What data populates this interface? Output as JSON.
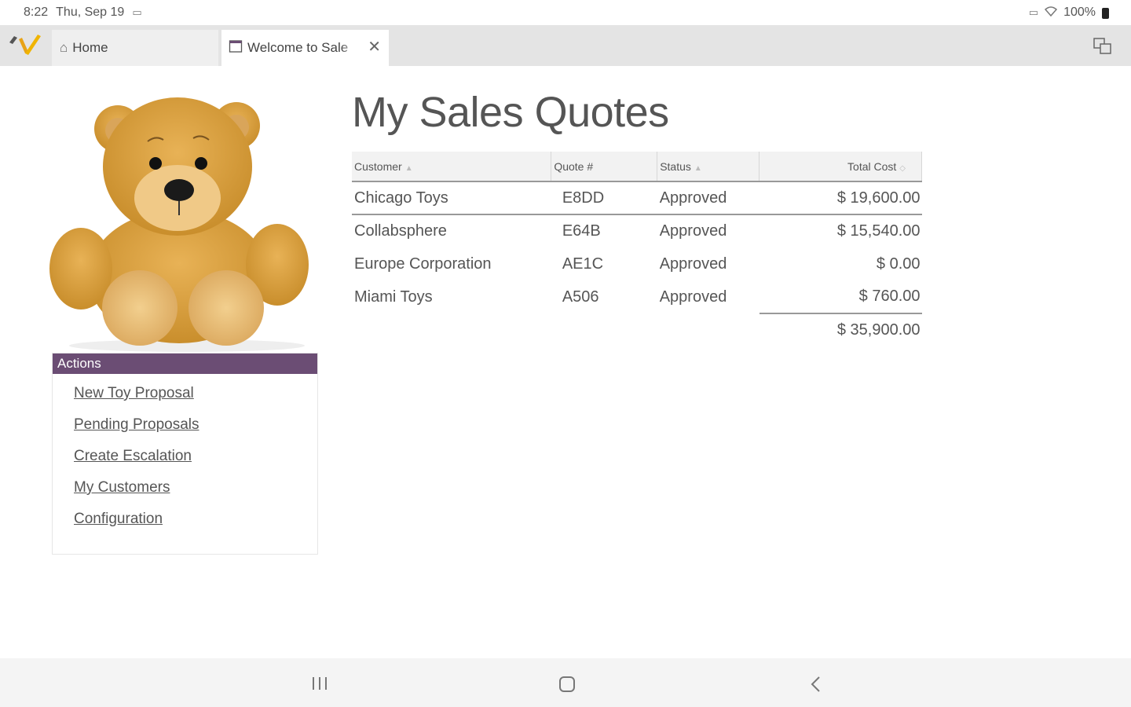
{
  "status_bar": {
    "time": "8:22",
    "date": "Thu, Sep 19",
    "battery": "100%"
  },
  "tabs": [
    {
      "label": "Home",
      "icon": "home-icon"
    },
    {
      "label": "Welcome to Sale",
      "icon": "page-icon"
    }
  ],
  "colors": {
    "actions_header": "#6b4d74",
    "tab_strip": "#e4e4e4"
  },
  "sidebar": {
    "image": "teddy-bear",
    "actions_title": "Actions",
    "links": [
      "New Toy Proposal",
      "Pending Proposals",
      "Create Escalation",
      "My Customers",
      "Configuration"
    ]
  },
  "main": {
    "title": "My Sales Quotes",
    "columns": [
      "Customer",
      "Quote #",
      "Status",
      "Total Cost"
    ],
    "rows": [
      {
        "customer": "Chicago Toys",
        "quote": "E8DD",
        "status": "Approved",
        "total": "$ 19,600.00"
      },
      {
        "customer": "Collabsphere",
        "quote": "E64B",
        "status": "Approved",
        "total": "$ 15,540.00"
      },
      {
        "customer": "Europe Corporation",
        "quote": "AE1C",
        "status": "Approved",
        "total": "$ 0.00"
      },
      {
        "customer": "Miami Toys",
        "quote": "A506",
        "status": "Approved",
        "total": "$ 760.00"
      }
    ],
    "grand_total": "$ 35,900.00"
  },
  "navbar": {
    "recent": "recent-apps-icon",
    "home": "home-circle-icon",
    "back": "back-icon"
  }
}
